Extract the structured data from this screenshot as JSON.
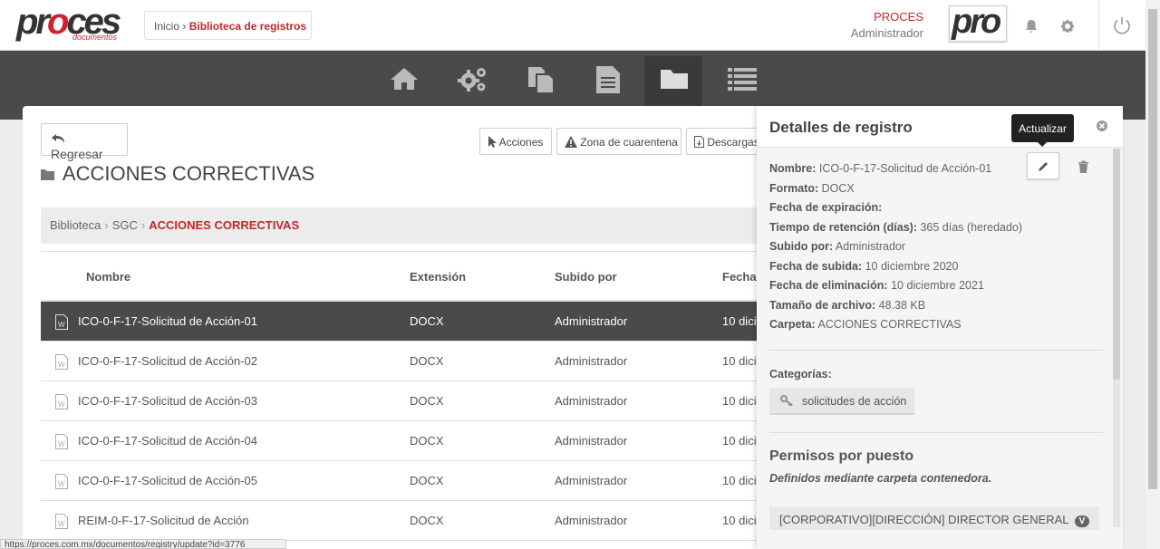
{
  "header": {
    "logo_text": "proces",
    "logo_sub": "documentos",
    "breadcrumb_home": "Inicio",
    "breadcrumb_current": "Biblioteca de registros",
    "company_name": "PROCES",
    "user_name": "Administrador",
    "brand_box_text": "pro"
  },
  "nav": {
    "items": [
      "home-icon",
      "gears-icon",
      "copy-docs-icon",
      "document-icon",
      "folder-icon",
      "list-icon"
    ],
    "active": "folder-icon"
  },
  "toolbar": {
    "back_label": "Regresar",
    "actions_label": "Acciones",
    "quarantine_label": "Zona de cuarentena",
    "downloads_label": "Descargas"
  },
  "folder": {
    "title": "ACCIONES CORRECTIVAS"
  },
  "breadcrumb": {
    "root": "Biblioteca",
    "middle": "SGC",
    "current": "ACCIONES CORRECTIVAS"
  },
  "table": {
    "headers": [
      "Nombre",
      "Extensión",
      "Subido por",
      "Fecha"
    ],
    "rows": [
      {
        "name": "ICO-0-F-17-Solicitud de Acción-01",
        "ext": "DOCX",
        "by": "Administrador",
        "date": "10 dici"
      },
      {
        "name": "ICO-0-F-17-Solicitud de Acción-02",
        "ext": "DOCX",
        "by": "Administrador",
        "date": "10 dici"
      },
      {
        "name": "ICO-0-F-17-Solicitud de Acción-03",
        "ext": "DOCX",
        "by": "Administrador",
        "date": "10 dici"
      },
      {
        "name": "ICO-0-F-17-Solicitud de Acción-04",
        "ext": "DOCX",
        "by": "Administrador",
        "date": "10 dici"
      },
      {
        "name": "ICO-0-F-17-Solicitud de Acción-05",
        "ext": "DOCX",
        "by": "Administrador",
        "date": "10 dici"
      },
      {
        "name": "REIM-0-F-17-Solicitud de Acción",
        "ext": "DOCX",
        "by": "Administrador",
        "date": "10 dici"
      }
    ]
  },
  "panel": {
    "title": "Detalles de registro",
    "tooltip": "Actualizar",
    "details": [
      {
        "label": "Nombre:",
        "value": " ICO-0-F-17-Solicitud de Acción-01"
      },
      {
        "label": "Formato:",
        "value": " DOCX"
      },
      {
        "label": "Fecha de expiración:",
        "value": ""
      },
      {
        "label": "Tiempo de retención (días):",
        "value": " 365 días (heredado)"
      },
      {
        "label": "Subido por:",
        "value": " Administrador"
      },
      {
        "label": "Fecha de subida:",
        "value": " 10 diciembre 2020"
      },
      {
        "label": "Fecha de eliminación:",
        "value": " 10 diciembre 2021"
      },
      {
        "label": "Tamaño de archivo:",
        "value": " 48.38 KB"
      },
      {
        "label": "Carpeta:",
        "value": " ACCIONES CORRECTIVAS"
      }
    ],
    "categories_label": "Categorías:",
    "category_chip": "solicitudes de acción",
    "permissions_title": "Permisos por puesto",
    "permissions_sub": "Definidos mediante carpeta contenedora.",
    "permission_item": "[CORPORATIVO][DIRECCIÓN] DIRECTOR GENERAL",
    "permission_badge": "V"
  },
  "status_url": "https://proces.com.mx/documentos/registry/update?id=3776"
}
